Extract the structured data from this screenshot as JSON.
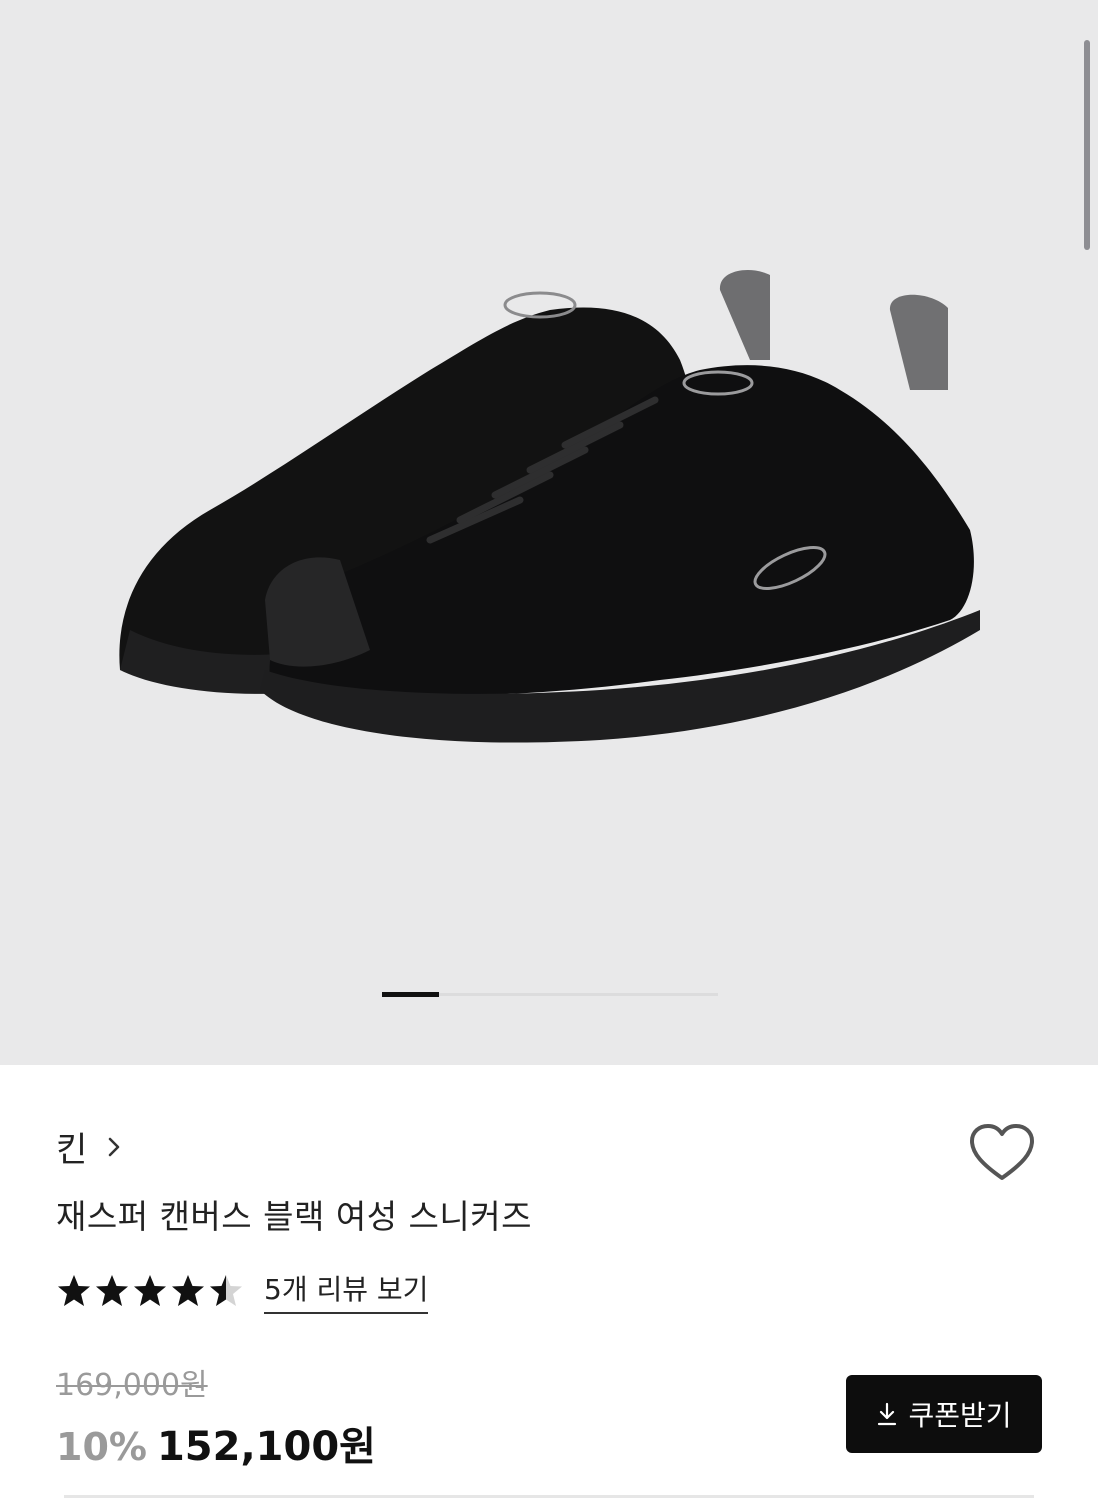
{
  "product": {
    "brand": "킨",
    "title": "재스퍼 캔버스 블랙 여성 스니커즈",
    "rating": 4.5,
    "rating_max": 5,
    "review_link": "5개 리뷰 보기",
    "original_price": "169,000원",
    "discount": "10%",
    "sale_price": "152,100원",
    "coupon_label": "쿠폰받기"
  },
  "gallery": {
    "current_slide": 1,
    "slide_progress": 0.17
  },
  "icons": {
    "brand_chevron": "chevron-right-icon",
    "wishlist": "heart-icon",
    "coupon": "download-icon",
    "star": "star-icon"
  },
  "colors": {
    "gallery_background": "#e9e9ea",
    "coupon_button": "#0d0d0d",
    "muted_text": "#9a9a9a"
  }
}
